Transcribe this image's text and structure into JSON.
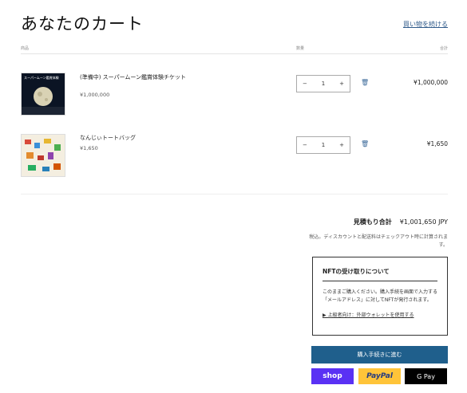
{
  "header": {
    "title": "あなたのカート",
    "continue_link": "買い物を続ける"
  },
  "table": {
    "col_product": "商品",
    "col_quantity": "数量",
    "col_total": "合計"
  },
  "items": [
    {
      "name": "(準備中) スーパームーン鑑賞体験チケット",
      "unit_price": "¥1,000,000",
      "quantity": "1",
      "line_total": "¥1,000,000",
      "thumb_caption": "スーパームーン鑑賞体験"
    },
    {
      "name": "なんじぃトートバッグ",
      "unit_price": "¥1,650",
      "quantity": "1",
      "line_total": "¥1,650"
    }
  ],
  "summary": {
    "estimate_label": "見積もり合計",
    "estimate_value": "¥1,001,650 JPY",
    "note": "税込。ディスカウントと配送料はチェックアウト時に計算されます。"
  },
  "nft": {
    "title": "NFTの受け取りについて",
    "body": "このままご購入ください。購入手続を画面で入力する「メールアドレス」に対してNFTが発行されます。",
    "link": "上級者向け：外部ウォレットを使用する"
  },
  "buttons": {
    "checkout": "購入手続きに進む",
    "shop_pay": "shop",
    "paypal": "PayPal",
    "gpay": "G Pay"
  },
  "colors": {
    "checkout_bg": "#1f5f8c",
    "shop_pay": "#5a31f4",
    "paypal": "#ffc439",
    "gpay": "#000000"
  }
}
